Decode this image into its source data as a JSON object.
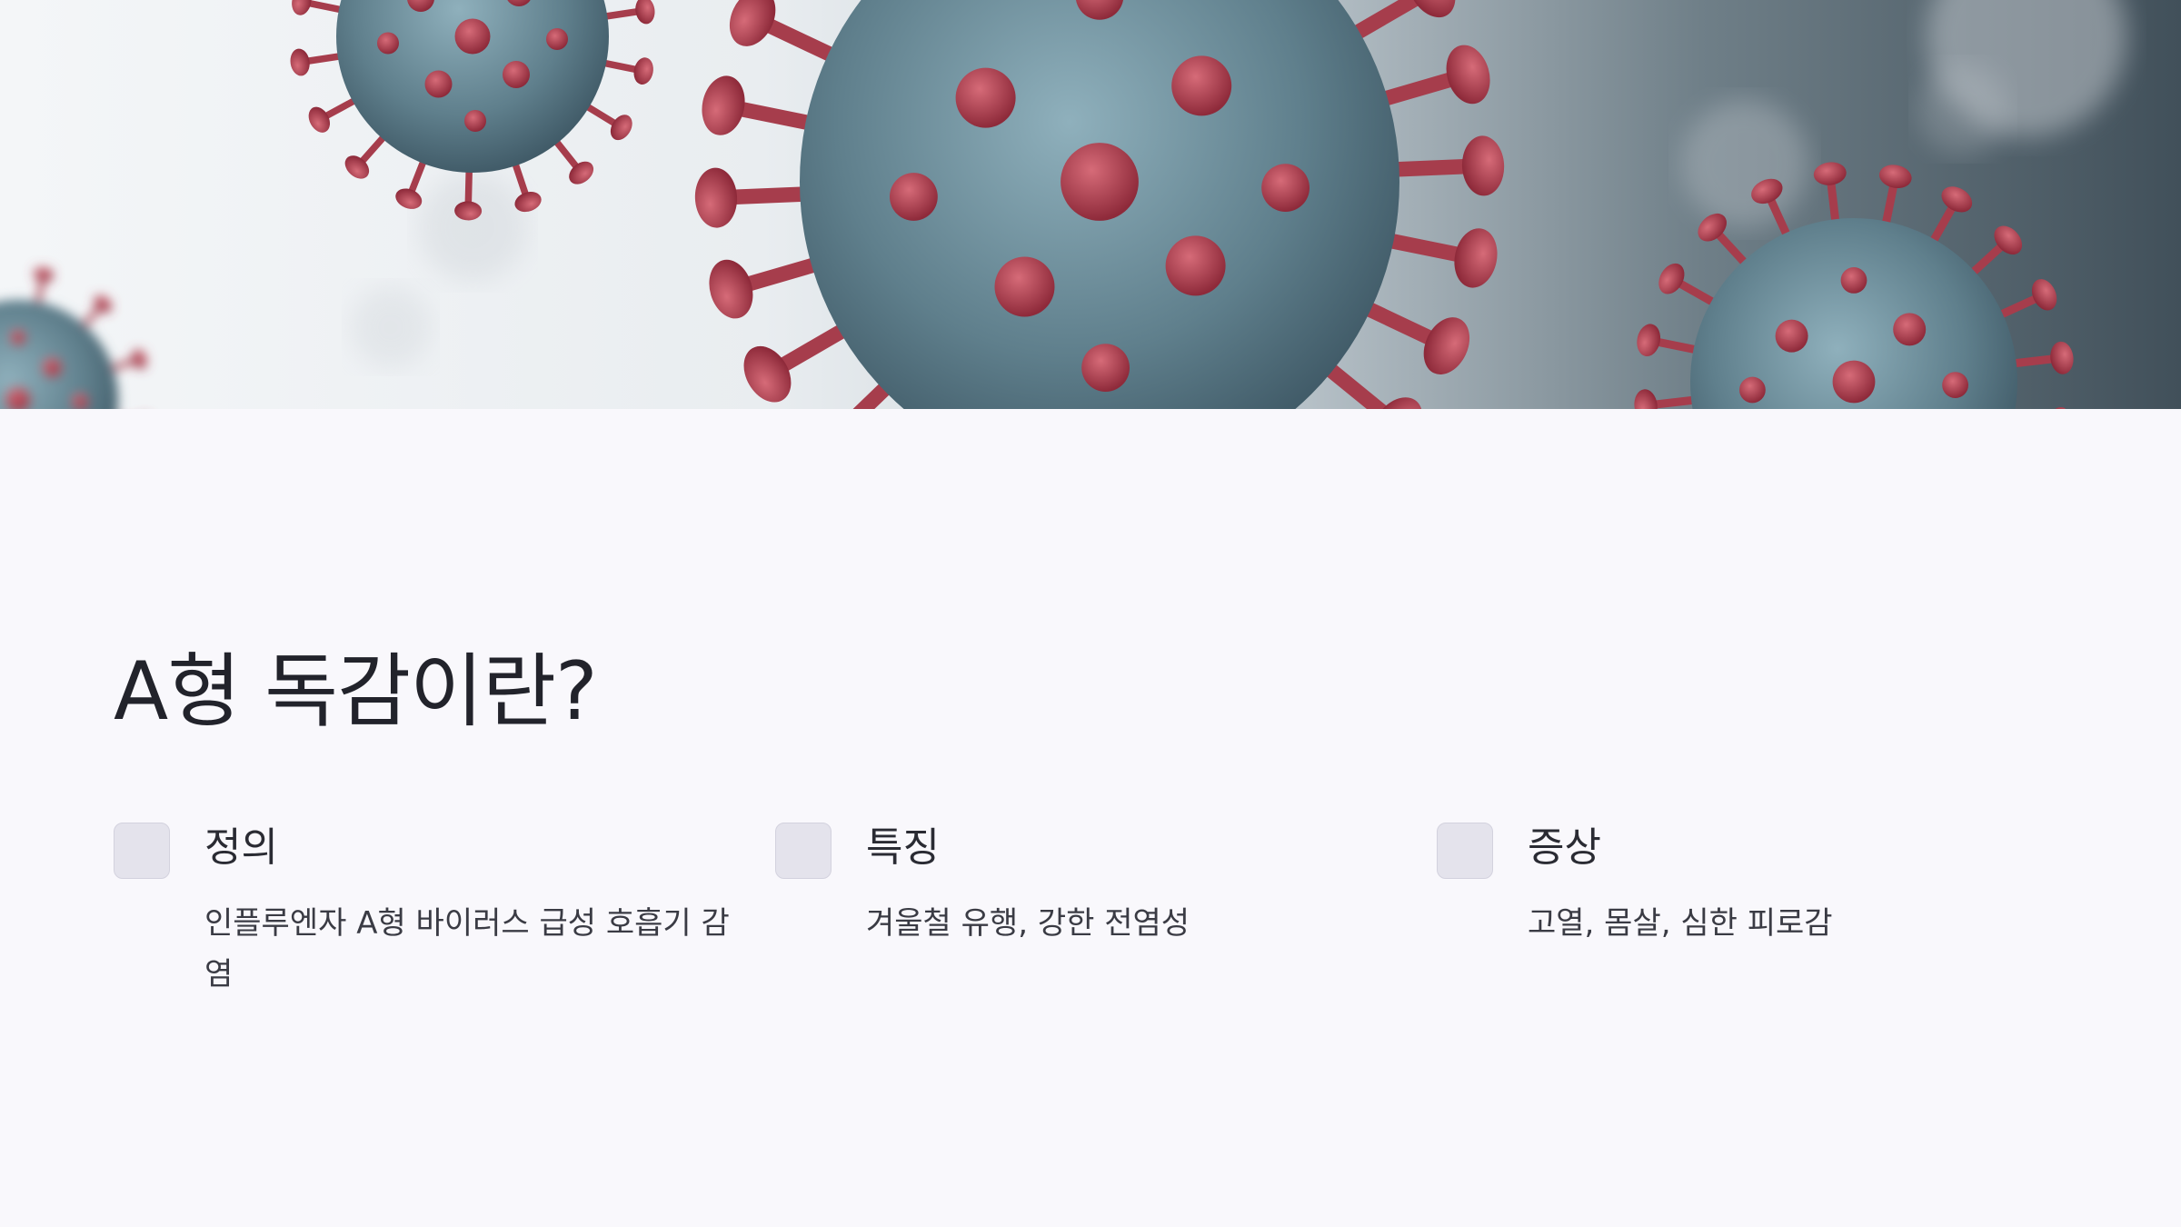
{
  "slide": {
    "title": "A형 독감이란?"
  },
  "hero": {
    "icon": "virus-illustration",
    "colors": {
      "virus_body": "#5f7f8c",
      "spike": "#a63d4c"
    }
  },
  "cards": [
    {
      "icon": "checkbox-icon",
      "title": "정의",
      "description": "인플루엔자 A형 바이러스 급성 호흡기 감염"
    },
    {
      "icon": "checkbox-icon",
      "title": "특징",
      "description": "겨울철 유행, 강한 전염성"
    },
    {
      "icon": "checkbox-icon",
      "title": "증상",
      "description": "고열, 몸살, 심한 피로감"
    }
  ],
  "colors": {
    "background": "#f9f8fc",
    "text": "#22232b",
    "icon_box": "#e4e3ec"
  }
}
